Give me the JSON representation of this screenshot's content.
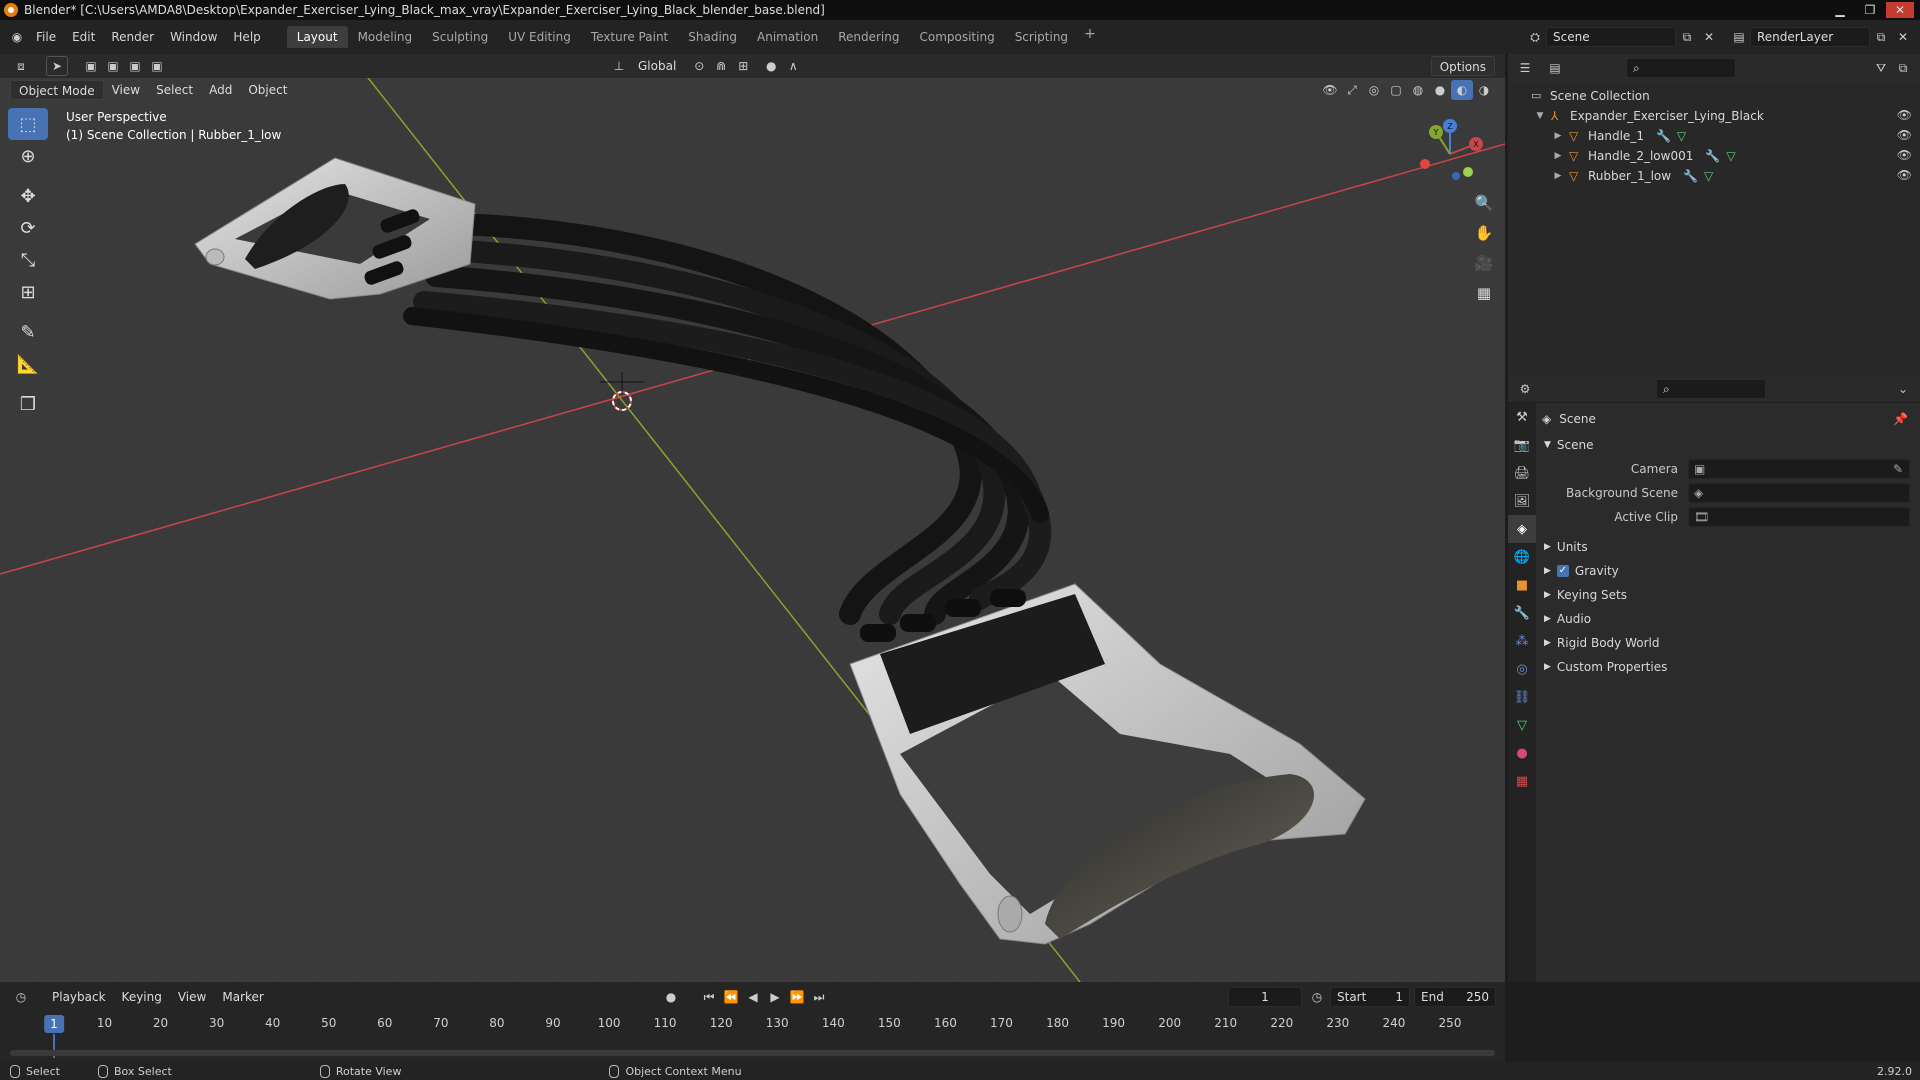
{
  "window": {
    "title": "Blender* [C:\\Users\\AMDA8\\Desktop\\Expander_Exerciser_Lying_Black_max_vray\\Expander_Exerciser_Lying_Black_blender_base.blend]"
  },
  "menubar": {
    "items": [
      "File",
      "Edit",
      "Render",
      "Window",
      "Help"
    ]
  },
  "workspaces": {
    "tabs": [
      "Layout",
      "Modeling",
      "Sculpting",
      "UV Editing",
      "Texture Paint",
      "Shading",
      "Animation",
      "Rendering",
      "Compositing",
      "Scripting"
    ],
    "active": "Layout",
    "add": "+"
  },
  "scene_selector": {
    "value": "Scene"
  },
  "renderlayer_selector": {
    "value": "RenderLayer"
  },
  "viewport": {
    "mode": "Object Mode",
    "menus": [
      "View",
      "Select",
      "Add",
      "Object"
    ],
    "orientation": "Global",
    "options_label": "Options",
    "info_line1": "User Perspective",
    "info_line2": "(1) Scene Collection | Rubber_1_low",
    "gizmo": {
      "x": "X",
      "y": "Y",
      "z": "Z"
    }
  },
  "outliner": {
    "root": "Scene Collection",
    "collection": "Expander_Exerciser_Lying_Black",
    "objects": [
      "Handle_1",
      "Handle_2_low001",
      "Rubber_1_low"
    ]
  },
  "properties": {
    "context": "Scene",
    "panel_title": "Scene",
    "fields": [
      {
        "label": "Camera"
      },
      {
        "label": "Background Scene"
      },
      {
        "label": "Active Clip"
      }
    ],
    "subpanels": [
      "Units",
      "Gravity",
      "Keying Sets",
      "Audio",
      "Rigid Body World",
      "Custom Properties"
    ],
    "gravity_checked": true
  },
  "timeline": {
    "menus": [
      "Playback",
      "Keying",
      "View",
      "Marker"
    ],
    "current_frame": "1",
    "start_label": "Start",
    "start_value": "1",
    "end_label": "End",
    "end_value": "250",
    "ticks": [
      "1",
      "10",
      "20",
      "30",
      "40",
      "50",
      "60",
      "70",
      "80",
      "90",
      "100",
      "110",
      "120",
      "130",
      "140",
      "150",
      "160",
      "170",
      "180",
      "190",
      "200",
      "210",
      "220",
      "230",
      "240",
      "250"
    ]
  },
  "statusbar": {
    "select": "Select",
    "box_select": "Box Select",
    "rotate_view": "Rotate View",
    "context_menu": "Object Context Menu",
    "version": "2.92.0"
  },
  "colors": {
    "accent": "#4772b3",
    "axis_x": "#c8464b",
    "axis_y": "#84a52f",
    "object_orange": "#e8922d"
  }
}
